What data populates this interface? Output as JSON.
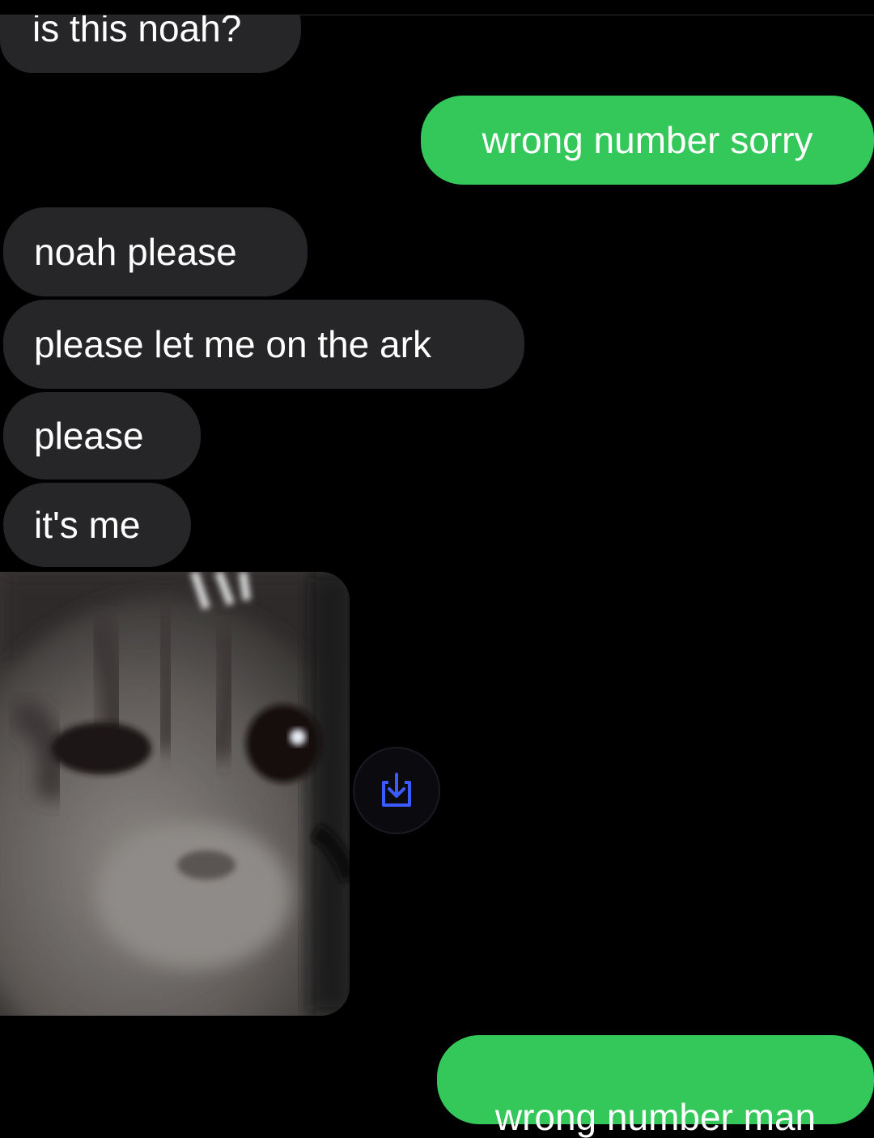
{
  "messages": [
    {
      "text": "is this noah?",
      "direction": "incoming"
    },
    {
      "text": "wrong number sorry",
      "direction": "outgoing"
    },
    {
      "text": "noah please",
      "direction": "incoming"
    },
    {
      "text": "please let me on the ark",
      "direction": "incoming"
    },
    {
      "text": "please",
      "direction": "incoming"
    },
    {
      "text": "it's me",
      "direction": "incoming"
    },
    {
      "text": "wrong number man",
      "direction": "outgoing"
    }
  ],
  "attachment": {
    "kind": "photo",
    "subject": "cat-photo"
  },
  "icons": {
    "save": "save-download-icon"
  },
  "colors": {
    "background": "#000000",
    "incoming_bubble": "#262628",
    "outgoing_bubble": "#34c759",
    "save_icon": "#3b5bff"
  }
}
